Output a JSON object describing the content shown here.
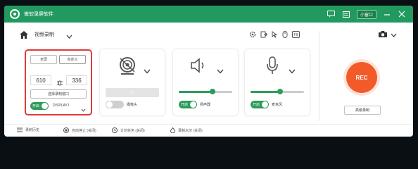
{
  "app": {
    "title": "傲软录屏软件"
  },
  "titlebar": {
    "mini_label": "小窗口"
  },
  "toolbar": {
    "mode_label": "视频录制"
  },
  "screen": {
    "fullscreen_label": "全屏",
    "custom_label": "自定义",
    "width": "610",
    "height": "336",
    "select_window_label": "选择录制窗口",
    "toggle_label": "开启",
    "display_label": "DISPLAY1"
  },
  "camera": {
    "disabled_label": "无",
    "toggle_label": "",
    "switch_label": "摄像头"
  },
  "system_audio": {
    "toggle_label": "开启",
    "label": "扬声器",
    "level": 0.63
  },
  "microphone": {
    "toggle_label": "开启",
    "label": "麦克风",
    "level": 0.55
  },
  "record": {
    "rec_label": "REC",
    "advanced_label": "高级录制"
  },
  "footer": {
    "items": [
      {
        "label": "录制历史"
      },
      {
        "label": "自动停止 (关闭)"
      },
      {
        "label": "计划任务 (关闭)"
      },
      {
        "label": "录制水印 (关闭)"
      }
    ]
  },
  "colors": {
    "brand_green": "#229a5f",
    "rec_orange": "#f25a2a",
    "selection_red": "#e03b3b"
  }
}
